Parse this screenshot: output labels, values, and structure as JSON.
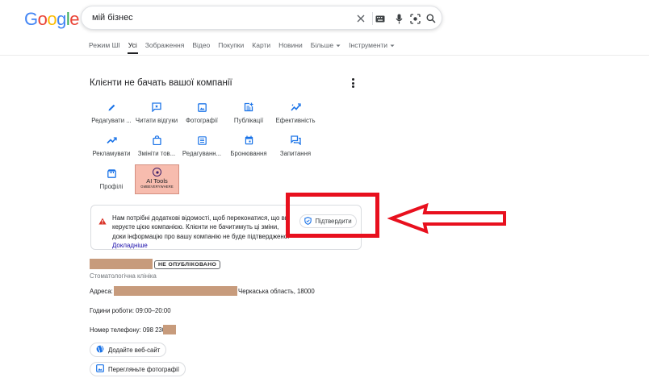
{
  "logo": {
    "letters": [
      {
        "char": "G",
        "color": "#4285f4"
      },
      {
        "char": "o",
        "color": "#ea4335"
      },
      {
        "char": "o",
        "color": "#fbbc05"
      },
      {
        "char": "g",
        "color": "#4285f4"
      },
      {
        "char": "l",
        "color": "#34a853"
      },
      {
        "char": "e",
        "color": "#ea4335"
      }
    ]
  },
  "search": {
    "query": "мій бізнес",
    "icons": [
      "clear-icon",
      "keyboard-icon",
      "microphone-icon",
      "lens-icon",
      "search-icon"
    ]
  },
  "tabs": [
    {
      "label": "Режим ШІ",
      "active": false
    },
    {
      "label": "Усі",
      "active": true
    },
    {
      "label": "Зображення",
      "active": false
    },
    {
      "label": "Відео",
      "active": false
    },
    {
      "label": "Покупки",
      "active": false
    },
    {
      "label": "Карти",
      "active": false
    },
    {
      "label": "Новини",
      "active": false
    },
    {
      "label": "Більше",
      "active": false,
      "dropdown": true
    },
    {
      "label": "Інструменти",
      "active": false,
      "dropdown": true
    }
  ],
  "panel": {
    "title": "Клієнти не бачать вашої компанії",
    "actions_row1": [
      {
        "label": "Редагувати ...",
        "icon": "pencil-icon"
      },
      {
        "label": "Читати відгуки",
        "icon": "reviews-icon"
      },
      {
        "label": "Фотографії",
        "icon": "photo-icon"
      },
      {
        "label": "Публікації",
        "icon": "post-add-icon"
      },
      {
        "label": "Ефективність",
        "icon": "performance-icon"
      }
    ],
    "actions_row2": [
      {
        "label": "Рекламувати",
        "icon": "trending-up-icon"
      },
      {
        "label": "Змініти тов...",
        "icon": "shopping-bag-icon"
      },
      {
        "label": "Редагуванн...",
        "icon": "list-icon"
      },
      {
        "label": "Бронювання",
        "icon": "calendar-icon"
      },
      {
        "label": "Запитання",
        "icon": "questions-icon"
      }
    ],
    "actions_row3": [
      {
        "label": "Профілі",
        "icon": "profiles-icon"
      }
    ],
    "ai_tool": {
      "name": "AI Tools",
      "sub": "GMBEVERYWHERE",
      "color": "#f7bcae"
    }
  },
  "alert": {
    "text": "Нам потрібні додаткові відомості, щоб переконатися, що ви керуєте цією компанією. Клієнти не бачитимуть ці зміни, доки інформацію про вашу компанію не буде підтверджено.",
    "link": "Докладніше",
    "button": "Підтвердити"
  },
  "business": {
    "badge": "НЕ ОПУБЛІКОВАНО",
    "category": "Стоматологічна клініка",
    "address_label": "Адреса:",
    "address_suffix": "Черкаська область, 18000",
    "hours_label": "Години роботи:",
    "hours_value": "09:00–20:00",
    "phone_label": "Номер телефону:",
    "phone_value": "098 230",
    "add_website": "Додайте веб-сайт",
    "view_photos": "Перегляньте фотографії"
  },
  "colors": {
    "accent": "#1a73e8",
    "annotation_red": "#e8101e",
    "redaction": "#c79b7c"
  }
}
